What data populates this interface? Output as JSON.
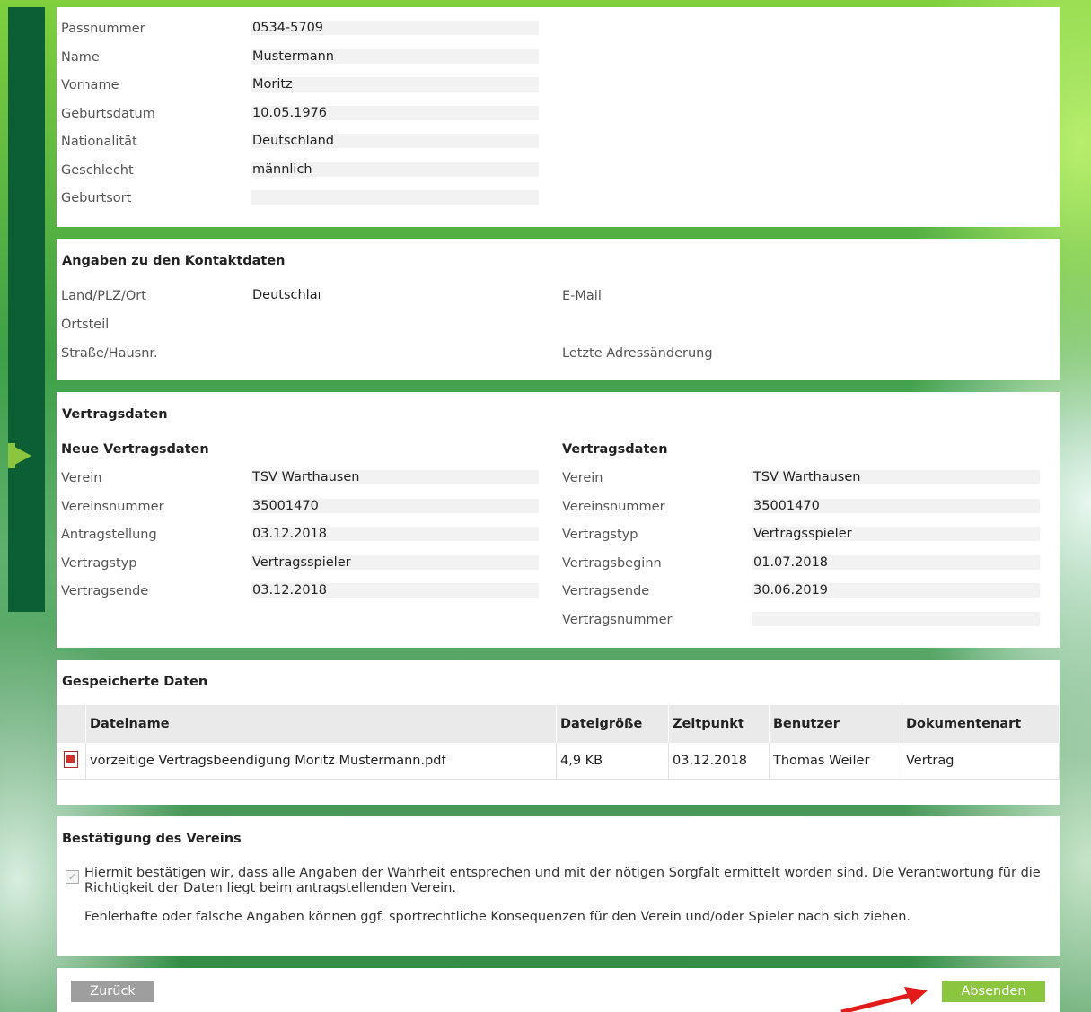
{
  "personal": {
    "rows": [
      {
        "label": "Passnummer",
        "value": "0534-5709"
      },
      {
        "label": "Name",
        "value": "Mustermann"
      },
      {
        "label": "Vorname",
        "value": "Moritz"
      },
      {
        "label": "Geburtsdatum",
        "value": "10.05.1976"
      },
      {
        "label": "Nationalität",
        "value": "Deutschland"
      },
      {
        "label": "Geschlecht",
        "value": "männlich"
      },
      {
        "label": "Geburtsort",
        "value": ""
      }
    ]
  },
  "contact": {
    "title": "Angaben zu den Kontaktdaten",
    "land_label": "Land/PLZ/Ort",
    "land_value": "Deutschland",
    "ortsteil_label": "Ortsteil",
    "strasse_label": "Straße/Hausnr.",
    "email_label": "E-Mail",
    "adress_label": "Letzte Adressänderung"
  },
  "contract": {
    "title": "Vertragsdaten",
    "new_title": "Neue Vertragsdaten",
    "old_title": "Vertragsdaten",
    "new_rows": [
      {
        "label": "Verein",
        "value": "TSV Warthausen"
      },
      {
        "label": "Vereinsnummer",
        "value": "35001470"
      },
      {
        "label": "Antragstellung",
        "value": "03.12.2018"
      },
      {
        "label": "Vertragstyp",
        "value": "Vertragsspieler"
      },
      {
        "label": "Vertragsende",
        "value": "03.12.2018"
      }
    ],
    "old_rows": [
      {
        "label": "Verein",
        "value": "TSV Warthausen"
      },
      {
        "label": "Vereinsnummer",
        "value": "35001470"
      },
      {
        "label": "Vertragstyp",
        "value": "Vertragsspieler"
      },
      {
        "label": "Vertragsbeginn",
        "value": "01.07.2018"
      },
      {
        "label": "Vertragsende",
        "value": "30.06.2019"
      },
      {
        "label": "Vertragsnummer",
        "value": ""
      }
    ]
  },
  "files": {
    "title": "Gespeicherte Daten",
    "headers": [
      "Dateiname",
      "Dateigröße",
      "Zeitpunkt",
      "Benutzer",
      "Dokumentenart"
    ],
    "rows": [
      {
        "name": "vorzeitige Vertragsbeendigung Moritz Mustermann.pdf",
        "size": "4,9 KB",
        "time": "03.12.2018",
        "user": "Thomas Weiler",
        "type": "Vertrag",
        "icon": "pdf-icon"
      }
    ]
  },
  "confirm": {
    "title": "Bestätigung des Vereins",
    "checked": true,
    "text": "Hiermit bestätigen wir, dass alle Angaben der Wahrheit entsprechen und mit der nötigen Sorgfalt ermittelt worden sind. Die Verantwortung für die Richtigkeit der Daten liegt beim antragstellenden Verein.",
    "note": "Fehlerhafte oder falsche Angaben können ggf. sportrechtliche Konsequenzen für den Verein und/oder Spieler nach sich ziehen."
  },
  "buttons": {
    "back": "Zurück",
    "submit": "Absenden"
  },
  "colors": {
    "back_button": "#9e9e9e",
    "submit_button": "#8cc63f",
    "annotation_arrow": "#e21b1b",
    "sidebar": "#0c5f34"
  }
}
